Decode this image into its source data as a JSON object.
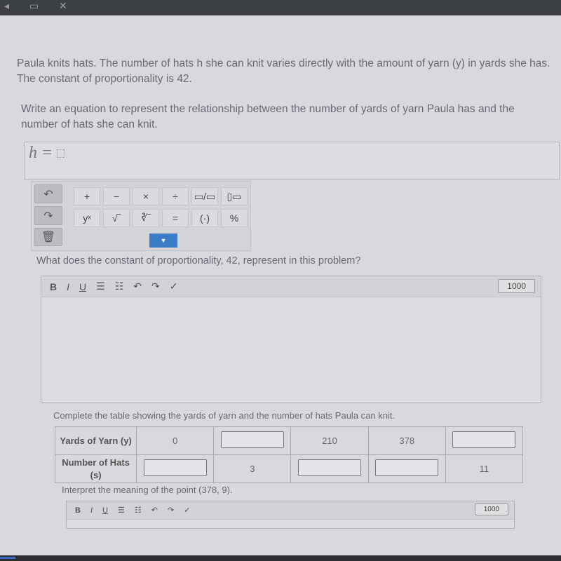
{
  "window": {
    "icons": [
      "back-icon",
      "copy-icon",
      "close-icon"
    ]
  },
  "question1": {
    "text": "Paula knits hats. The number of hats h she can knit varies directly with the amount of yarn (y) in yards she has. The constant of proportionality is 42."
  },
  "question2": {
    "text": "Write an equation to represent the relationship between the number of yards of yarn Paula has and the number of hats she can knit.",
    "equation_prefix": "h ="
  },
  "keypad": {
    "row1": [
      "+",
      "−",
      "×",
      "÷",
      "▭/▭",
      "▯▭"
    ],
    "row2": [
      "yˣ",
      "√‾",
      "∛‾",
      "=",
      "(·)",
      "%"
    ],
    "side": [
      "undo",
      "redo",
      "trash"
    ],
    "dropdown": "▼"
  },
  "question3": {
    "text": "What does the constant of proportionality, 42, represent in this problem?",
    "char_limit": "1000"
  },
  "editor_toolbar": [
    "B",
    "I",
    "U",
    "☰",
    "☷",
    "↶",
    "↷",
    "✓"
  ],
  "question4": {
    "text": "Complete the table showing the yards of yarn and the number of hats Paula can knit."
  },
  "table": {
    "row1": {
      "header": "Yards of Yarn (y)",
      "cells": [
        "0",
        "",
        "210",
        "378",
        ""
      ]
    },
    "row2": {
      "header": "Number of Hats (s)",
      "cells": [
        "",
        "3",
        "",
        "",
        "11"
      ]
    }
  },
  "question5": {
    "text": "Interpret the meaning of the point (378, 9).",
    "char_limit": "1000"
  }
}
